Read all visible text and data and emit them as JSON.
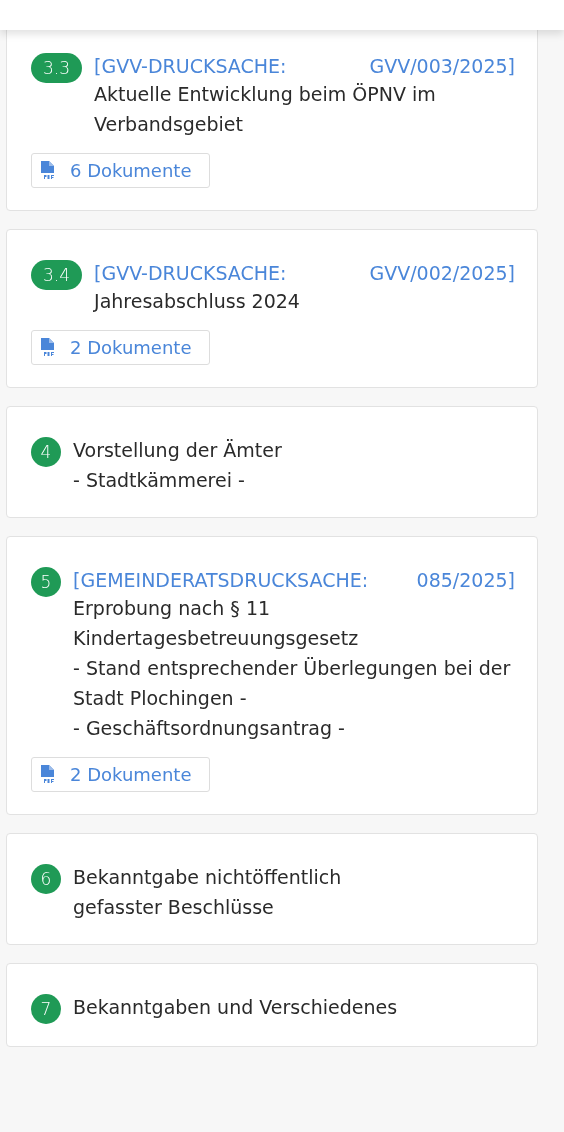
{
  "items": [
    {
      "number": "3.3",
      "reference": "[GVV-DRUCKSACHE: GVV/003/2025]",
      "title": "Aktuelle Entwicklung beim ÖPNV im Verbandsgebiet",
      "documents": "6 Dokumente"
    },
    {
      "number": "3.4",
      "reference": "[GVV-DRUCKSACHE: GVV/002/2025]",
      "title": "Jahresabschluss 2024",
      "documents": "2 Dokumente"
    },
    {
      "number": "4",
      "title": "Vorstellung der Ämter\n- Stadtkämmerei -"
    },
    {
      "number": "5",
      "reference": "[GEMEINDERATSDRUCKSACHE: 085/2025]",
      "title": "Erprobung nach § 11 Kindertagesbetreuungsgesetz\n- Stand entsprechender Überlegungen bei der Stadt Plochingen -\n- Geschäftsordnungsantrag -",
      "documents": "2 Dokumente"
    },
    {
      "number": "6",
      "title": "Bekanntgabe nichtöffentlich\ngefasster Beschlüsse"
    },
    {
      "number": "7",
      "title": "Bekanntgaben und Verschiedenes"
    }
  ]
}
